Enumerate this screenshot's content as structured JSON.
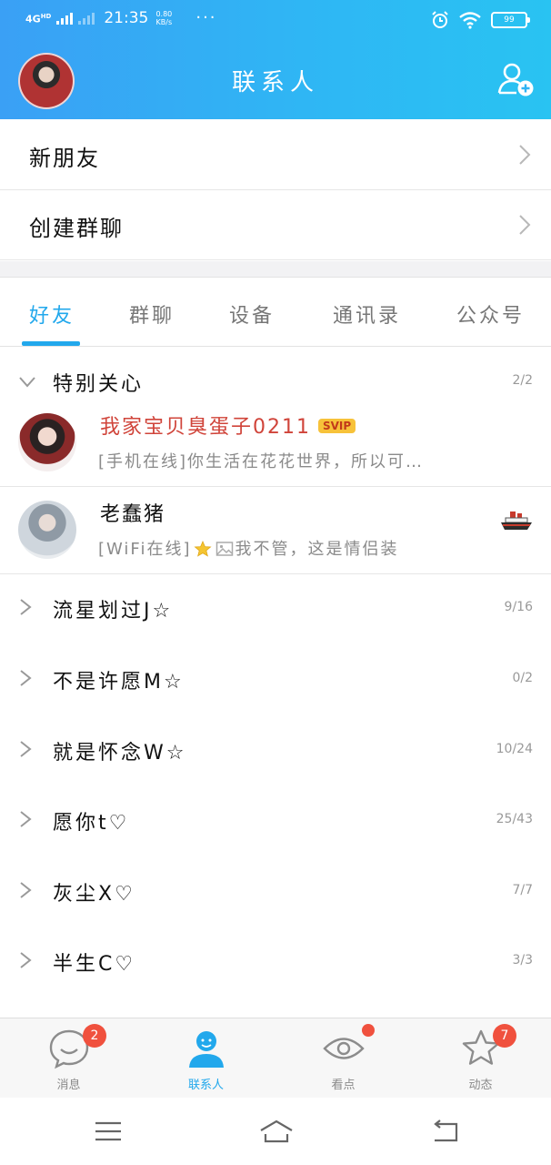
{
  "status_bar": {
    "network": "4G",
    "network_sup": "HD",
    "time": "21:35",
    "speed_value": "0.80",
    "speed_unit": "KB/s",
    "more": "···",
    "battery": "99"
  },
  "header": {
    "title": "联系人"
  },
  "entries": [
    {
      "label": "新朋友"
    },
    {
      "label": "创建群聊"
    }
  ],
  "tabs": [
    {
      "label": "好友",
      "active": true
    },
    {
      "label": "群聊",
      "active": false
    },
    {
      "label": "设备",
      "active": false
    },
    {
      "label": "通讯录",
      "active": false
    },
    {
      "label": "公众号",
      "active": false
    }
  ],
  "special_group": {
    "name": "特别关心",
    "count": "2/2"
  },
  "friends": [
    {
      "name": "我家宝贝臭蛋子0211",
      "badge": "SVIP",
      "status_prefix": "[手机在线]",
      "status_text": "你生活在花花世界，所以可…"
    },
    {
      "name": "老蠢猪",
      "status_prefix": "[WiFi在线]",
      "status_text": "我不管，这是情侣装"
    }
  ],
  "groups": [
    {
      "name": "流星划过J☆",
      "count": "9/16"
    },
    {
      "name": "不是许愿M☆",
      "count": "0/2"
    },
    {
      "name": "就是怀念W☆",
      "count": "10/24"
    },
    {
      "name": "愿你t♡",
      "count": "25/43"
    },
    {
      "name": "灰尘X♡",
      "count": "7/7"
    },
    {
      "name": "半生C♡",
      "count": "3/3"
    }
  ],
  "tabbar": {
    "messages": {
      "label": "消息",
      "badge": "2"
    },
    "contacts": {
      "label": "联系人"
    },
    "discover": {
      "label": "看点"
    },
    "moments": {
      "label": "动态",
      "badge": "7"
    }
  },
  "colors": {
    "accent": "#22a8ec",
    "header_gradient_start": "#3aa0f5",
    "header_gradient_end": "#29c3f2",
    "badge_red": "#f0513e",
    "vip_name": "#d0443a"
  }
}
